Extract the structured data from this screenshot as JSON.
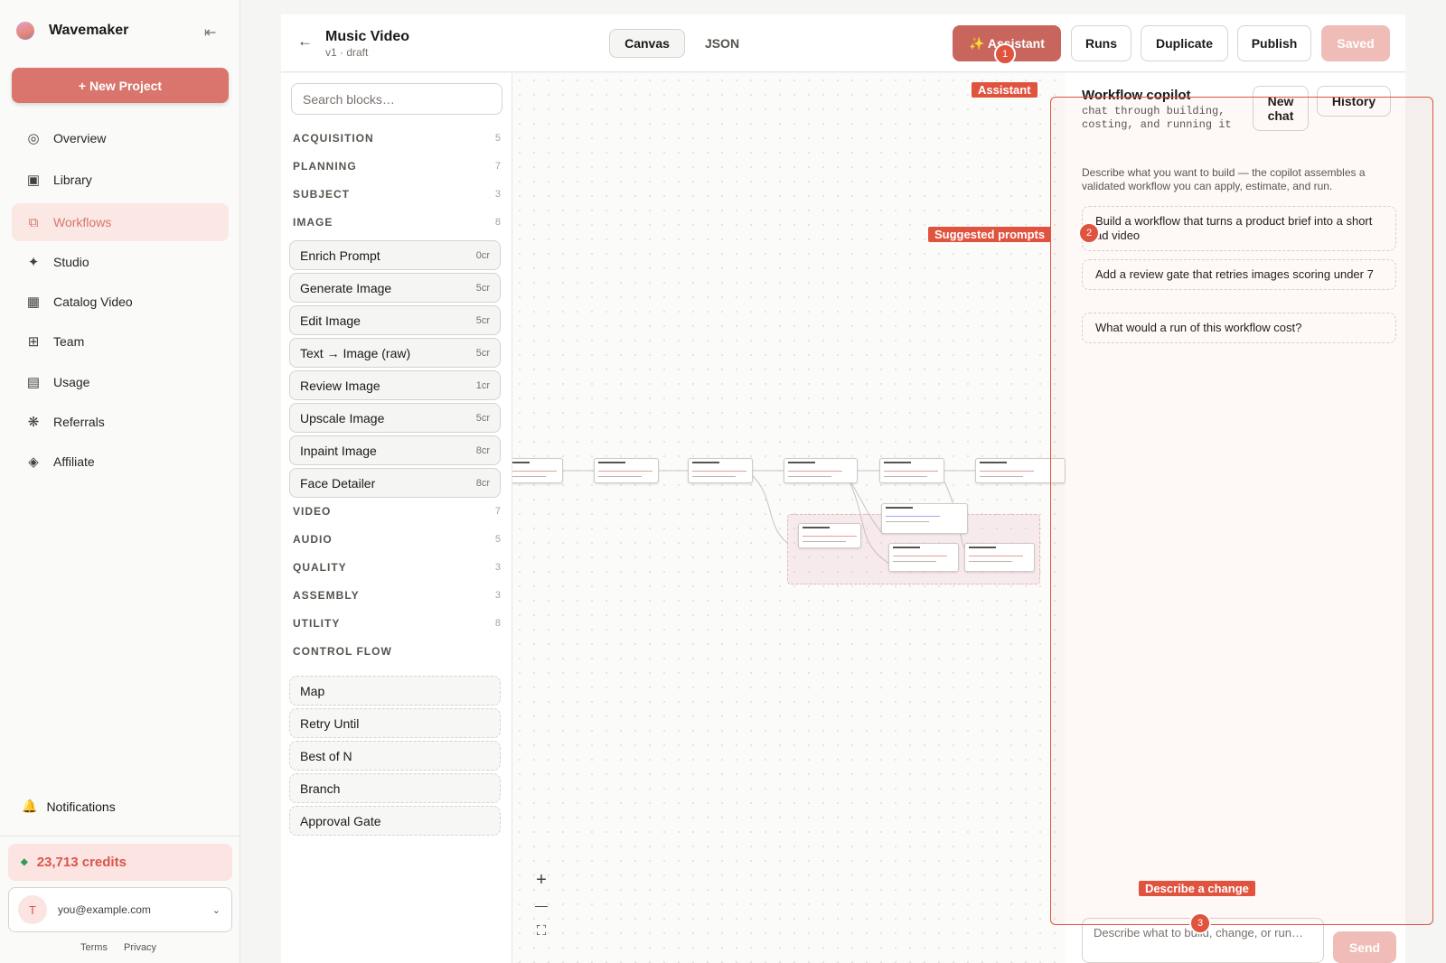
{
  "app": {
    "name": "Wavemaker",
    "new_project": "+ New Project",
    "nav": [
      {
        "label": "Overview",
        "icon": "overview-icon"
      },
      {
        "label": "Library",
        "icon": "library-icon"
      },
      {
        "label": "Workflows",
        "icon": "workflows-icon"
      },
      {
        "label": "Studio",
        "icon": "studio-icon"
      },
      {
        "label": "Catalog Video",
        "icon": "catalog-icon"
      },
      {
        "label": "Team",
        "icon": "team-icon"
      },
      {
        "label": "Usage",
        "icon": "usage-icon"
      },
      {
        "label": "Referrals",
        "icon": "referrals-icon"
      },
      {
        "label": "Affiliate",
        "icon": "affiliate-icon"
      }
    ],
    "notifications": "Notifications",
    "credits": "23,713 credits",
    "user": {
      "initial": "T",
      "email": "you@example.com"
    },
    "footer": {
      "terms": "Terms",
      "privacy": "Privacy"
    }
  },
  "header": {
    "title": "Music Video",
    "subtitle": "v1 · draft",
    "tabs": [
      "Canvas",
      "JSON"
    ],
    "active_tab": "Canvas",
    "buttons": {
      "assistant": "✨ Assistant",
      "runs": "Runs",
      "duplicate": "Duplicate",
      "publish": "Publish",
      "saved": "Saved"
    }
  },
  "palette": {
    "search_placeholder": "Search blocks…",
    "categories": [
      {
        "name": "ACQUISITION",
        "count": "5"
      },
      {
        "name": "PLANNING",
        "count": "7"
      },
      {
        "name": "SUBJECT",
        "count": "3"
      },
      {
        "name": "IMAGE",
        "count": "8"
      },
      {
        "name": "VIDEO",
        "count": "7"
      },
      {
        "name": "AUDIO",
        "count": "5"
      },
      {
        "name": "QUALITY",
        "count": "3"
      },
      {
        "name": "ASSEMBLY",
        "count": "3"
      },
      {
        "name": "UTILITY",
        "count": "8"
      },
      {
        "name": "CONTROL FLOW",
        "count": ""
      }
    ],
    "image_blocks": [
      {
        "name": "Enrich Prompt",
        "cost": "0cr"
      },
      {
        "name": "Generate Image",
        "cost": "5cr"
      },
      {
        "name": "Edit Image",
        "cost": "5cr"
      },
      {
        "name": "Text → Image (raw)",
        "cost": "5cr"
      },
      {
        "name": "Review Image",
        "cost": "1cr"
      },
      {
        "name": "Upscale Image",
        "cost": "5cr"
      },
      {
        "name": "Inpaint Image",
        "cost": "8cr"
      },
      {
        "name": "Face Detailer",
        "cost": "8cr"
      }
    ],
    "control_blocks": [
      "Map",
      "Retry Until",
      "Best of N",
      "Branch",
      "Approval Gate"
    ]
  },
  "canvas": {
    "zoom_in": "+",
    "zoom_out": "—",
    "fit": "⛶"
  },
  "copilot": {
    "title": "Workflow copilot",
    "subtitle": "chat through building, costing, and running it",
    "new_chat": "New chat",
    "history": "History",
    "description": "Describe what you want to build — the copilot assembles a validated workflow you can apply, estimate, and run.",
    "prompts": [
      "Build a workflow that turns a product brief into a short ad video",
      "Add a review gate that retries images scoring under 7",
      "What would a run of this workflow cost?"
    ],
    "compose_placeholder": "Describe what to build, change, or run…",
    "send": "Send"
  },
  "annotations": {
    "labels": [
      "Assistant",
      "Suggested prompts",
      "Describe a change"
    ],
    "pins": [
      "1",
      "2",
      "3"
    ]
  },
  "colors": {
    "accent": "#d9756c",
    "annotation": "#e0533f",
    "success": "#2e9c5a"
  }
}
